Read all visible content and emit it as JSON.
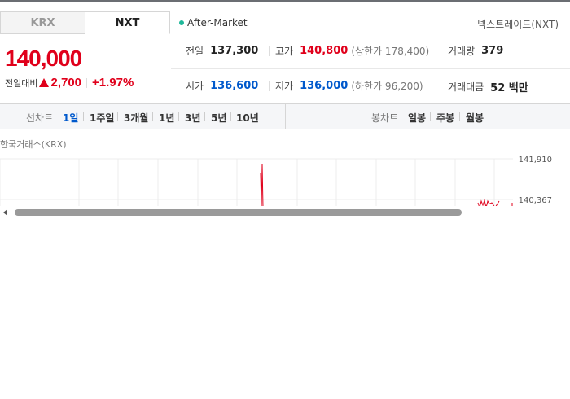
{
  "tabs": [
    {
      "label": "KRX",
      "active": false
    },
    {
      "label": "NXT",
      "active": true
    }
  ],
  "session": {
    "label": "After-Market",
    "dot_color": "#1fb89a"
  },
  "exchange_name": "넥스트레이드(NXT)",
  "quote": {
    "price": "140,000",
    "change_label": "전일대비",
    "change_value": "2,700",
    "change_percent": "+1.97%",
    "direction": "up",
    "up_color": "#e0001b",
    "down_color": "#0059cc"
  },
  "stats": {
    "prev_close": {
      "label": "전일",
      "value": "137,300"
    },
    "high": {
      "label": "고가",
      "value": "140,800",
      "sub": "(상한가 178,400)"
    },
    "volume": {
      "label": "거래량",
      "value": "379"
    },
    "open": {
      "label": "시가",
      "value": "136,600"
    },
    "low": {
      "label": "저가",
      "value": "136,000",
      "sub": "(하한가 96,200)"
    },
    "trade_value": {
      "label": "거래대금",
      "value": "52 백만"
    }
  },
  "line_chart_toolbar": {
    "label": "선차트",
    "periods": [
      "1일",
      "1주일",
      "3개월",
      "1년",
      "3년",
      "5년",
      "10년"
    ],
    "active_period": "1일"
  },
  "candle_chart_toolbar": {
    "label": "봉차트",
    "periods": [
      "일봉",
      "주봉",
      "월봉"
    ]
  },
  "chart": {
    "source_label": "한국거래소(KRX)",
    "line_color": "#e0001b"
  },
  "chart_data": {
    "type": "line",
    "title": "",
    "xlabel": "",
    "ylabel": "",
    "y_tick_labels": [
      "141,910",
      "140,367"
    ],
    "ylim": [
      140100,
      142100
    ],
    "grid": true,
    "series": [
      {
        "values": [
          141500,
          140100,
          141900,
          140100,
          140300,
          140100,
          140367,
          140200,
          140400,
          140100,
          140367,
          140250,
          140300,
          140100,
          140367,
          140300
        ]
      }
    ]
  },
  "scrollbar": {
    "thumb_fraction": 0.81
  }
}
